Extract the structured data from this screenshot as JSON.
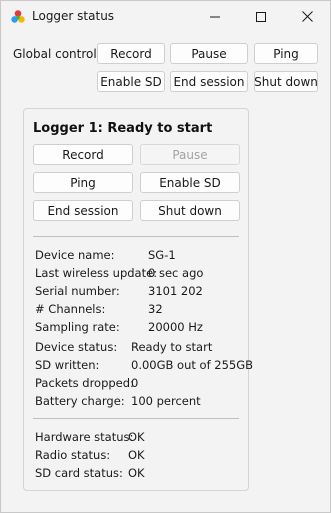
{
  "window": {
    "title": "Logger status"
  },
  "global": {
    "label": "Global control:",
    "buttons": {
      "record": "Record",
      "pause": "Pause",
      "ping": "Ping",
      "enable_sd": "Enable SD",
      "end_session": "End session",
      "shut_down": "Shut down"
    }
  },
  "logger": {
    "title": "Logger 1: Ready to start",
    "buttons": {
      "record": "Record",
      "pause": "Pause",
      "ping": "Ping",
      "enable_sd": "Enable SD",
      "end_session": "End session",
      "shut_down": "Shut down"
    },
    "pause_disabled": true,
    "info": [
      {
        "label": "Device name:",
        "value": "SG-1"
      },
      {
        "label": "Last wireless update:",
        "value": "0 sec ago"
      },
      {
        "label": "Serial number:",
        "value": "3101 202"
      },
      {
        "label": "# Channels:",
        "value": "32"
      },
      {
        "label": "Sampling rate:",
        "value": "20000 Hz"
      }
    ],
    "status": [
      {
        "label": "Device status:",
        "value": "Ready to start"
      },
      {
        "label": "SD written:",
        "value": "0.00GB out of 255GB"
      },
      {
        "label": "Packets dropped:",
        "value": "0"
      },
      {
        "label": "Battery charge:",
        "value": "100 percent"
      }
    ],
    "health": [
      {
        "label": "Hardware status:",
        "value": "OK"
      },
      {
        "label": "Radio status:",
        "value": "OK"
      },
      {
        "label": "SD card status:",
        "value": "OK"
      }
    ]
  },
  "icons": {
    "app": "app-logo-icon",
    "minimize": "minimize-icon",
    "maximize": "maximize-icon",
    "close": "close-icon"
  }
}
